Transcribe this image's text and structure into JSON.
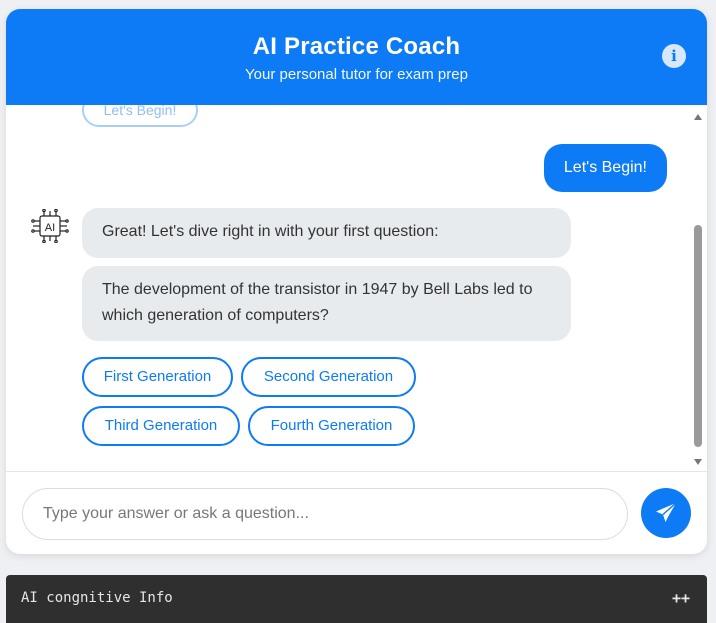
{
  "header": {
    "title": "AI Practice Coach",
    "subtitle": "Your personal tutor for exam prep",
    "info_icon": "i"
  },
  "messages": {
    "previous_chip": "Let's Begin!",
    "user_message": "Let's Begin!",
    "avatar_label": "AI",
    "bot_intro": "Great! Let's dive right in with your first question:",
    "bot_question": "The development of the transistor in 1947 by Bell Labs led to which generation of computers?",
    "options": [
      "First Generation",
      "Second Generation",
      "Third Generation",
      "Fourth Generation"
    ]
  },
  "composer": {
    "placeholder": "Type your answer or ask a question...",
    "send_icon": "send-icon"
  },
  "info_bar": {
    "label": "AI congnitive Info",
    "toggle": "++"
  },
  "colors": {
    "accent": "#0d7bf5",
    "bubble_bg": "#e8ebee",
    "info_bar_bg": "#2f2f2f"
  }
}
